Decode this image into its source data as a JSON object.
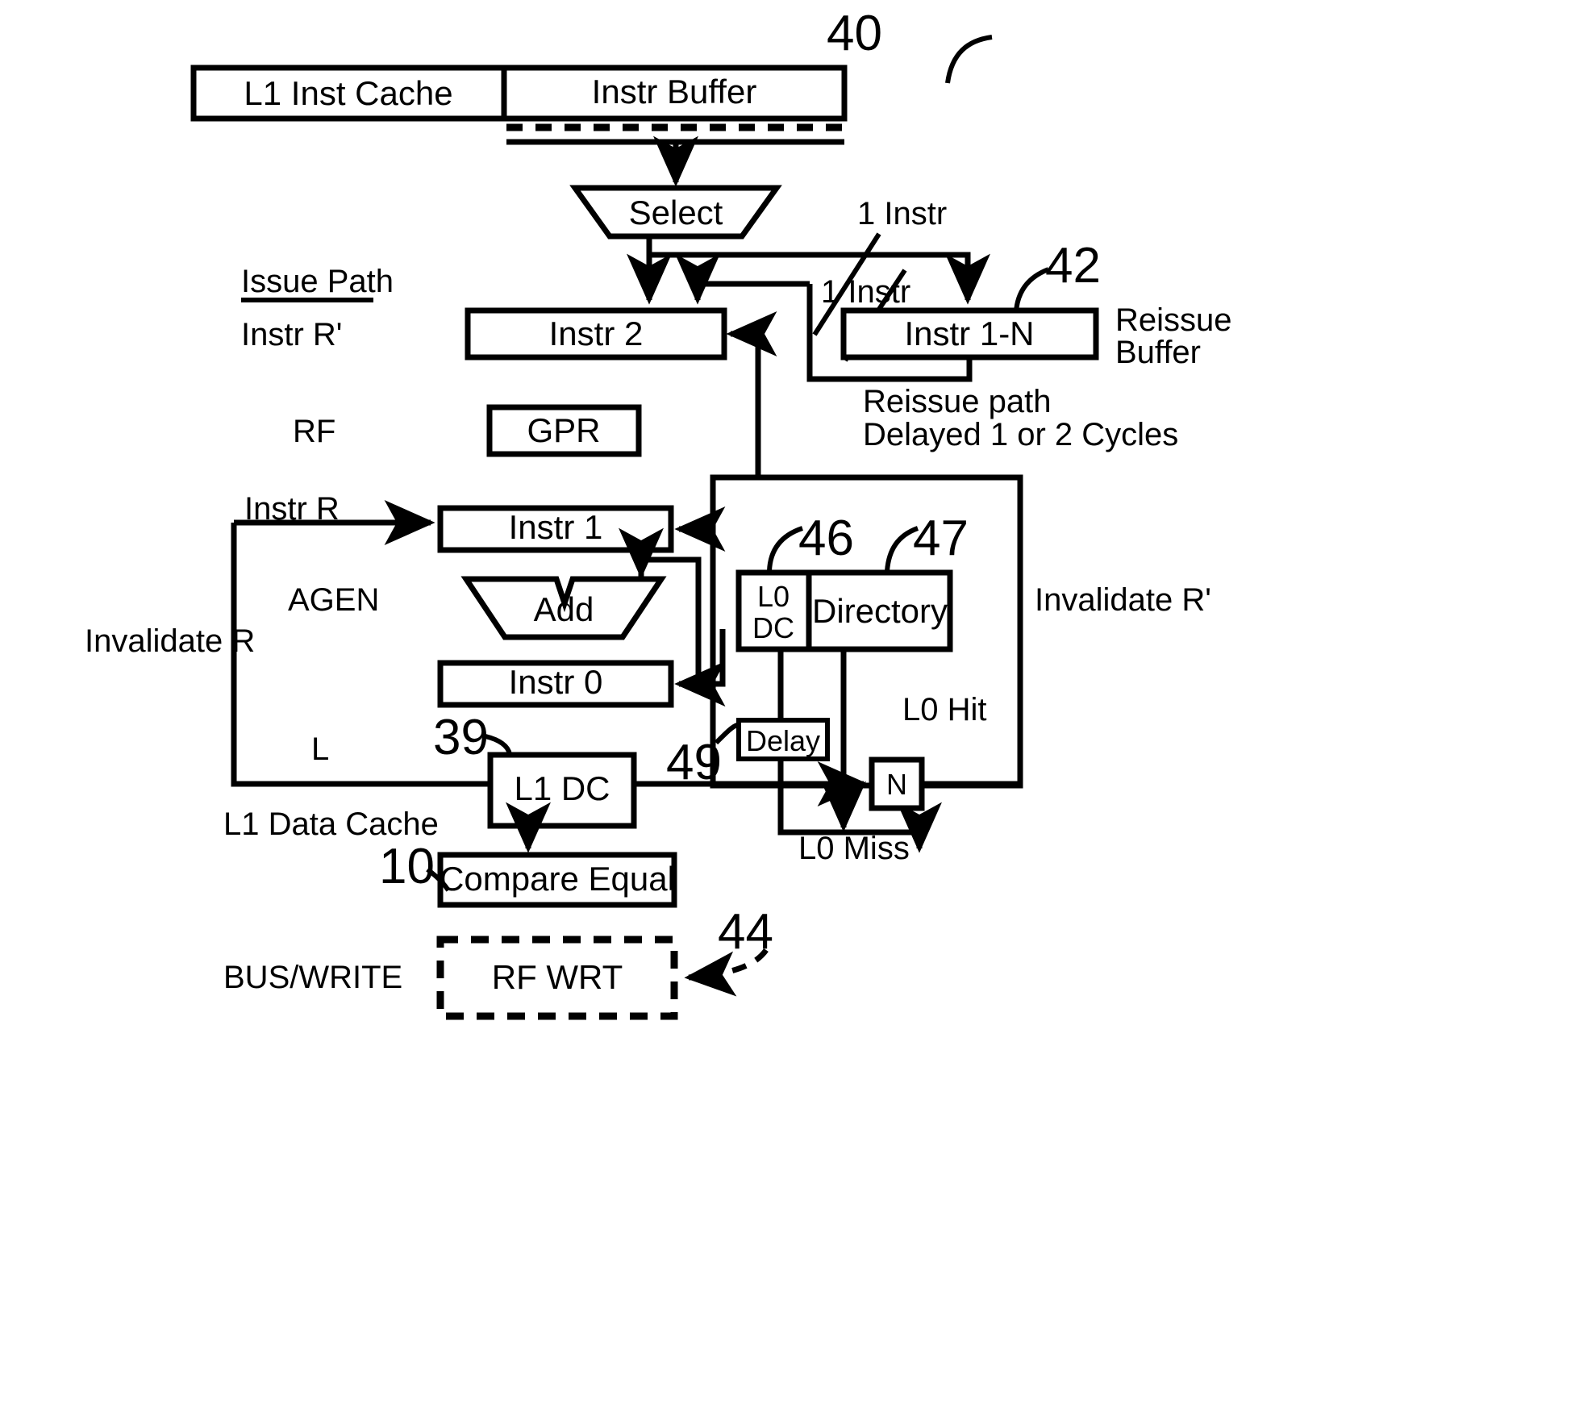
{
  "figure": {
    "title": "Processor pipeline block diagram with L0 data cache and reissue buffer",
    "type": "diagram"
  },
  "boxes": {
    "l1_inst_cache": "L1 Inst Cache",
    "instr_buffer": "Instr Buffer",
    "select": "Select",
    "instr2": "Instr 2",
    "instr1n": "Instr 1-N",
    "gpr": "GPR",
    "instr1": "Instr 1",
    "add": "Add",
    "instr0": "Instr 0",
    "l0dc_line1": "L0",
    "l0dc_line2": "DC",
    "directory": "Directory",
    "delay": "Delay",
    "n": "N",
    "l1dc": "L1 DC",
    "compare_equal": "Compare Equal",
    "rf_wrt": "RF WRT"
  },
  "stage_labels": {
    "issue_path": "Issue Path",
    "instr_r_prime": "Instr R'",
    "rf": "RF",
    "agen": "AGEN",
    "l": "L",
    "l1_data_cache": "L1 Data Cache",
    "bus_write": "BUS/WRITE"
  },
  "signal_labels": {
    "one_instr_upper": "1 Instr",
    "one_instr_lower": "1 Instr",
    "reissue_buffer": "Reissue\nBuffer",
    "reissue_buffer_line1": "Reissue",
    "reissue_buffer_line2": "Buffer",
    "reissue_path_line1": "Reissue path",
    "reissue_path_line2": "Delayed 1 or 2 Cycles",
    "instr_r": "Instr R",
    "invalidate_r": "Invalidate R",
    "invalidate_r_prime": "Invalidate R'",
    "l0_hit": "L0 Hit",
    "l0_miss": "L0 Miss"
  },
  "reference_numerals": {
    "n40": "40",
    "n42": "42",
    "n46": "46",
    "n47": "47",
    "n39": "39",
    "n49": "49",
    "n10": "10",
    "n44": "44"
  },
  "colors": {
    "stroke": "#000000",
    "background": "#ffffff"
  }
}
